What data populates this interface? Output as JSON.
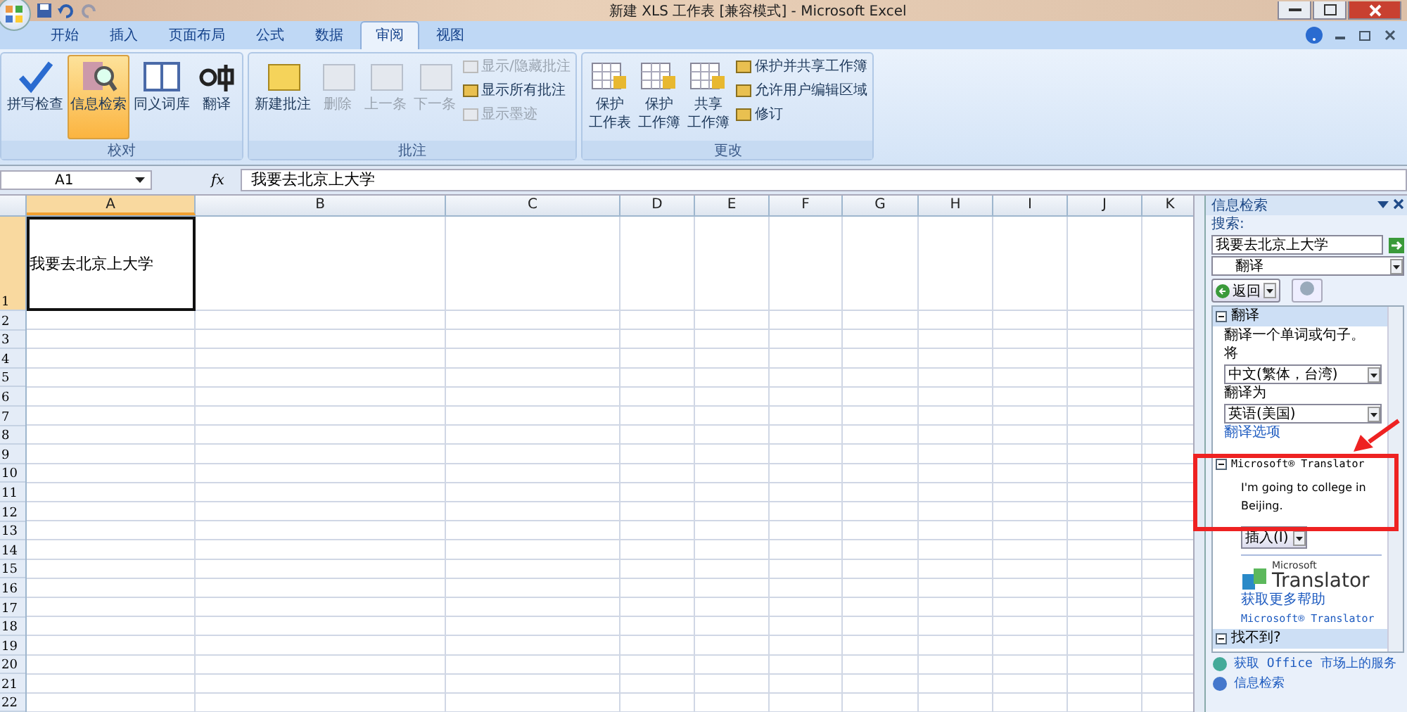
{
  "window": {
    "title": "新建 XLS 工作表  [兼容模式] - Microsoft Excel"
  },
  "tabs": [
    {
      "label": "开始",
      "selected": false
    },
    {
      "label": "插入",
      "selected": false
    },
    {
      "label": "页面布局",
      "selected": false
    },
    {
      "label": "公式",
      "selected": false
    },
    {
      "label": "数据",
      "selected": false
    },
    {
      "label": "审阅",
      "selected": true
    },
    {
      "label": "视图",
      "selected": false
    }
  ],
  "ribbon_groups": [
    {
      "label": "校对",
      "buttons": [
        {
          "lines": [
            "拼写检查"
          ],
          "selected": false,
          "disabled": false
        },
        {
          "lines": [
            "信息检索"
          ],
          "selected": true,
          "disabled": false
        },
        {
          "lines": [
            "同义词库"
          ],
          "selected": false,
          "disabled": false
        },
        {
          "lines": [
            "翻译"
          ],
          "selected": false,
          "disabled": false
        }
      ]
    },
    {
      "label": "批注",
      "buttons": [
        {
          "lines": [
            "新建批注"
          ],
          "selected": false,
          "disabled": false
        },
        {
          "lines": [
            "删除"
          ],
          "selected": false,
          "disabled": true
        },
        {
          "lines": [
            "上一条"
          ],
          "selected": false,
          "disabled": true
        },
        {
          "lines": [
            "下一条"
          ],
          "selected": false,
          "disabled": true
        }
      ],
      "small_buttons": [
        {
          "label": "显示/隐藏批注",
          "disabled": true
        },
        {
          "label": "显示所有批注",
          "disabled": false
        },
        {
          "label": "显示墨迹",
          "disabled": true
        }
      ]
    },
    {
      "label": "更改",
      "buttons": [
        {
          "lines": [
            "保护",
            "工作表"
          ],
          "selected": false,
          "disabled": false
        },
        {
          "lines": [
            "保护",
            "工作簿"
          ],
          "selected": false,
          "disabled": false
        },
        {
          "lines": [
            "共享",
            "工作簿"
          ],
          "selected": false,
          "disabled": false
        }
      ],
      "small_buttons": [
        {
          "label": "保护并共享工作簿",
          "disabled": false
        },
        {
          "label": "允许用户编辑区域",
          "disabled": false
        },
        {
          "label": "修订",
          "disabled": false
        }
      ]
    }
  ],
  "formula_bar": {
    "name_box": "A1",
    "fx": "fx",
    "value": "我要去北京上大学"
  },
  "sheet": {
    "columns": [
      "A",
      "B",
      "C",
      "D",
      "E",
      "F",
      "G",
      "H",
      "I",
      "J",
      "K"
    ],
    "rows": [
      "1",
      "2",
      "3",
      "4",
      "5",
      "6",
      "7",
      "8",
      "9",
      "10",
      "11",
      "12",
      "13",
      "14",
      "15",
      "16",
      "17",
      "18",
      "19",
      "20",
      "21",
      "22"
    ],
    "cells": [
      {
        "text": "我要去北京上大学",
        "selected": true
      }
    ]
  },
  "task_pane": {
    "title": "信息检索",
    "search_label": "搜索:",
    "search_value": "我要去北京上大学",
    "source": "翻译",
    "back_button": "返回",
    "sections": [
      {
        "title": "翻译",
        "expanded": true,
        "description": "翻译一个单词或句子。",
        "from_label": "将",
        "from_value": "中文(繁体，台湾)",
        "to_label": "翻译为",
        "to_value": "英语(美国)",
        "options_link": "翻译选项"
      },
      {
        "title": "Microsoft® Translator",
        "expanded": true,
        "result": "I'm going to college in Beijing.",
        "insert_button": "插入(I)",
        "logo_small": "Microsoft",
        "logo_big": "Translator",
        "links": [
          "获取更多帮助",
          "Microsoft® Translator"
        ]
      },
      {
        "title": "找不到?",
        "expanded": true
      }
    ],
    "footer_links": [
      "获取 Office 市场上的服务",
      "信息检索"
    ]
  }
}
